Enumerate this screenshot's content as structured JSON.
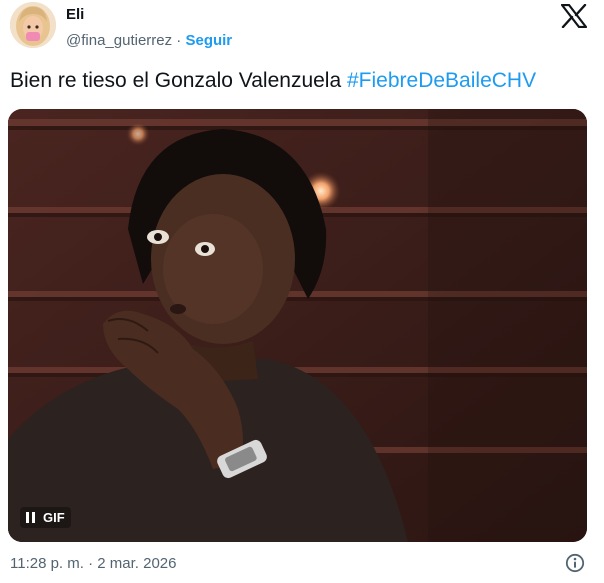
{
  "author": {
    "display_name": "Eli",
    "handle": "@fina_gutierrez",
    "separator": "·",
    "follow_label": "Seguir",
    "avatar_icon": "memoji-avatar"
  },
  "brand_icon": "x-logo-icon",
  "tweet": {
    "text": "Bien re tieso el Gonzalo Valenzuela",
    "hashtag": "#FiebreDeBaileCHV"
  },
  "media": {
    "badge_label": "GIF",
    "control_icon": "pause-icon"
  },
  "footer": {
    "timestamp": "11:28 p. m. · 2 mar. 2026",
    "info_icon": "info-icon"
  },
  "colors": {
    "accent": "#1d9bf0",
    "text": "#0f1419",
    "muted": "#536471"
  }
}
